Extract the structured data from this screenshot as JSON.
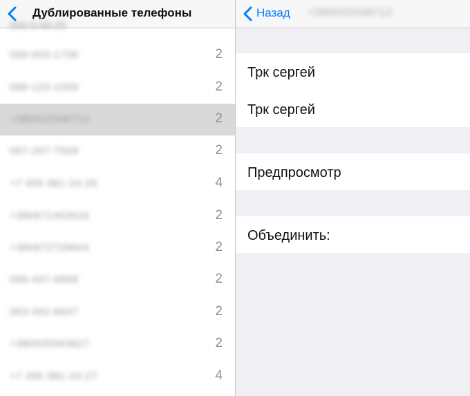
{
  "left_panel": {
    "nav_title": "Дублированные телефоны",
    "top_peek": "050-5-66-25",
    "rows": [
      {
        "phone": "066-903-1736",
        "count": "2",
        "selected": false
      },
      {
        "phone": "096-125-1509",
        "count": "2",
        "selected": false
      },
      {
        "phone": "+380503348712",
        "count": "2",
        "selected": true
      },
      {
        "phone": "067-297-7509",
        "count": "2",
        "selected": false
      },
      {
        "phone": "+7 495 981-24-26",
        "count": "4",
        "selected": false
      },
      {
        "phone": "+380671403916",
        "count": "2",
        "selected": false
      },
      {
        "phone": "+380672729604",
        "count": "2",
        "selected": false
      },
      {
        "phone": "096-447-6808",
        "count": "2",
        "selected": false
      },
      {
        "phone": "063-492-8647",
        "count": "2",
        "selected": false
      },
      {
        "phone": "+380935563827",
        "count": "2",
        "selected": false
      },
      {
        "phone": "+7 495 981-24-27",
        "count": "4",
        "selected": false
      }
    ]
  },
  "right_panel": {
    "back_label": "Назад",
    "nav_title_blurred": "+380503348712",
    "contacts": [
      "Трк сергей",
      "Трк сергей"
    ],
    "preview_label": "Предпросмотр",
    "merge_label": "Объединить:"
  },
  "colors": {
    "accent": "#007aff",
    "selected_row": "#d9d9d9",
    "grouped_background": "#efeff4",
    "count_text": "#8e8e93"
  },
  "icons": {
    "left_back": "chevron-left-icon",
    "right_back": "chevron-left-icon"
  }
}
